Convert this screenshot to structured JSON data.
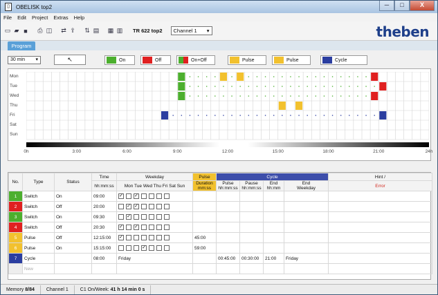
{
  "window": {
    "title": "OBELISK top2",
    "minimize": "─",
    "maximize": "□",
    "close": "X"
  },
  "menu": [
    "File",
    "Edit",
    "Project",
    "Extras",
    "Help"
  ],
  "toolbar": {
    "model": "TR 622 top2",
    "channel": "Channel 1",
    "logo": "theben"
  },
  "tab": "Program",
  "legend": {
    "interval": "30 min",
    "items": [
      {
        "label": "On",
        "color": "#4caf2e"
      },
      {
        "label": "Off",
        "color": "#e02020"
      },
      {
        "label": "On+Off",
        "color": "#4caf2e"
      },
      {
        "label": "Pulse",
        "color": "#f2c12e"
      },
      {
        "label": "Pulse",
        "color": "#f2c12e"
      },
      {
        "label": "Cycle",
        "color": "#2b3ea0"
      }
    ]
  },
  "timeline": {
    "days": [
      "Mon",
      "Tue",
      "Wed",
      "Thu",
      "Fri",
      "Sat",
      "Sun"
    ],
    "hours": [
      "0h",
      "3:00",
      "6:00",
      "9:00",
      "12:00",
      "15:00",
      "18:00",
      "21:00",
      "24h"
    ],
    "events": [
      {
        "day": 0,
        "slot": 18,
        "kind": "on"
      },
      {
        "day": 0,
        "slot": 23,
        "kind": "pulse"
      },
      {
        "day": 0,
        "slot": 25,
        "kind": "pulse"
      },
      {
        "day": 0,
        "slot": 41,
        "kind": "off"
      },
      {
        "day": 1,
        "slot": 18,
        "kind": "on"
      },
      {
        "day": 1,
        "slot": 42,
        "kind": "off"
      },
      {
        "day": 2,
        "slot": 18,
        "kind": "on"
      },
      {
        "day": 2,
        "slot": 41,
        "kind": "off"
      },
      {
        "day": 3,
        "slot": 30,
        "kind": "pulse"
      },
      {
        "day": 3,
        "slot": 32,
        "kind": "pulse"
      },
      {
        "day": 4,
        "slot": 16,
        "kind": "cycle"
      },
      {
        "day": 4,
        "slot": 42,
        "kind": "cycle"
      }
    ],
    "dotted": [
      {
        "day": 0,
        "from": 18,
        "to": 41,
        "color": "#4caf2e"
      },
      {
        "day": 1,
        "from": 18,
        "to": 42,
        "color": "#4caf2e"
      },
      {
        "day": 2,
        "from": 18,
        "to": 41,
        "color": "#4caf2e"
      },
      {
        "day": 4,
        "from": 16,
        "to": 42,
        "color": "#2b3ea0"
      }
    ]
  },
  "table": {
    "headers": {
      "no": "No.",
      "type": "Type",
      "status": "Status",
      "time": "Time",
      "time_unit": "hh:mm:ss",
      "weekday": "Weekday",
      "weekdays": "Mon Tue Wed Thu  Fri  Sat Sun",
      "pulse": "Pulse",
      "duration": "Duration",
      "duration_unit": "mm:ss",
      "cycle": "Cycle",
      "c_pulse": "Pulse",
      "c_pulse_unit": "hh:mm:ss",
      "c_pause": "Pause",
      "c_pause_unit": "hh:mm:ss",
      "c_end": "End",
      "c_end_unit": "hh:mm",
      "c_endwd": "End",
      "c_endwd2": "Weekday",
      "hint": "Hint /",
      "error": "Error"
    },
    "rows": [
      {
        "no": "1",
        "color": "#4caf2e",
        "type": "Switch",
        "status": "On",
        "time": "09:00",
        "days": [
          1,
          0,
          1,
          0,
          0,
          0,
          0
        ],
        "dur": "",
        "cp": "",
        "cpa": "",
        "ce": "",
        "cew": ""
      },
      {
        "no": "2",
        "color": "#e02020",
        "type": "Switch",
        "status": "Off",
        "time": "20:00",
        "days": [
          0,
          1,
          1,
          0,
          0,
          0,
          0
        ],
        "dur": "",
        "cp": "",
        "cpa": "",
        "ce": "",
        "cew": ""
      },
      {
        "no": "3",
        "color": "#4caf2e",
        "type": "Switch",
        "status": "On",
        "time": "09:30",
        "days": [
          0,
          1,
          0,
          0,
          0,
          0,
          0
        ],
        "dur": "",
        "cp": "",
        "cpa": "",
        "ce": "",
        "cew": ""
      },
      {
        "no": "4",
        "color": "#e02020",
        "type": "Switch",
        "status": "Off",
        "time": "20:30",
        "days": [
          1,
          0,
          1,
          0,
          0,
          0,
          0
        ],
        "dur": "",
        "cp": "",
        "cpa": "",
        "ce": "",
        "cew": ""
      },
      {
        "no": "5",
        "color": "#f2c12e",
        "type": "Pulse",
        "status": "Off",
        "time": "12:15:00",
        "days": [
          1,
          0,
          0,
          0,
          0,
          0,
          0
        ],
        "dur": "45:00",
        "cp": "",
        "cpa": "",
        "ce": "",
        "cew": ""
      },
      {
        "no": "6",
        "color": "#f2c12e",
        "type": "Pulse",
        "status": "On",
        "time": "15:15:00",
        "days": [
          0,
          0,
          0,
          1,
          0,
          0,
          0
        ],
        "dur": "59:00",
        "cp": "",
        "cpa": "",
        "ce": "",
        "cew": ""
      },
      {
        "no": "7",
        "color": "#2b3ea0",
        "type": "Cycle",
        "status": "",
        "time": "08:00",
        "weektext": "Friday",
        "dur": "",
        "cp": "00:45:00",
        "cpa": "00:30:00",
        "ce": "21:00",
        "cew": "Friday"
      }
    ],
    "new": "New"
  },
  "status": {
    "memory_label": "Memory",
    "memory": "8/84",
    "channel": "Channel 1",
    "week_label": "C1 On/Week:",
    "week": "41 h 14 min 0 s"
  }
}
